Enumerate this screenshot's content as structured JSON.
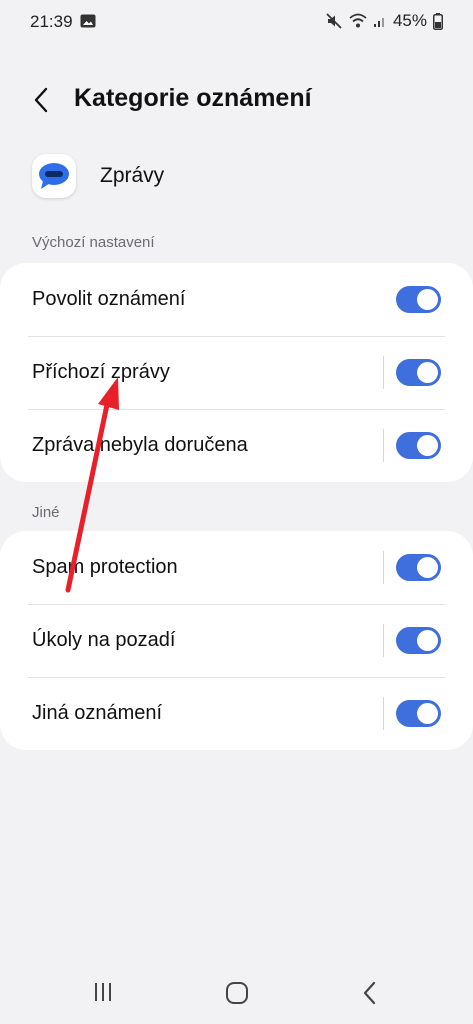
{
  "status_bar": {
    "time": "21:39",
    "battery": "45%",
    "icons": [
      "gallery-icon",
      "mute-icon",
      "wifi-icon",
      "signal-icon",
      "battery-icon"
    ]
  },
  "header": {
    "back_icon": "back-chevron-icon",
    "title": "Kategorie oznámení"
  },
  "app": {
    "icon": "messages-app-icon",
    "name": "Zprávy"
  },
  "sections": [
    {
      "header": "Výchozí nastavení",
      "rows": [
        {
          "label": "Povolit oznámení",
          "toggle_on": true,
          "has_divider": false
        },
        {
          "label": "Příchozí zprávy",
          "toggle_on": true,
          "has_divider": true
        },
        {
          "label": "Zpráva nebyla doručena",
          "toggle_on": true,
          "has_divider": true
        }
      ]
    },
    {
      "header": "Jiné",
      "rows": [
        {
          "label": "Spam protection",
          "toggle_on": true,
          "has_divider": true
        },
        {
          "label": "Úkoly na pozadí",
          "toggle_on": true,
          "has_divider": true
        },
        {
          "label": "Jiná oznámení",
          "toggle_on": true,
          "has_divider": true
        }
      ]
    }
  ],
  "nav_bar": {
    "icons": [
      "recents-icon",
      "home-icon",
      "back-icon"
    ]
  },
  "colors": {
    "background": "#f2f2f4",
    "card": "#ffffff",
    "toggle_on": "#3f6fdc",
    "annotation_arrow": "#e8202a",
    "section_header": "#6b6b70"
  }
}
